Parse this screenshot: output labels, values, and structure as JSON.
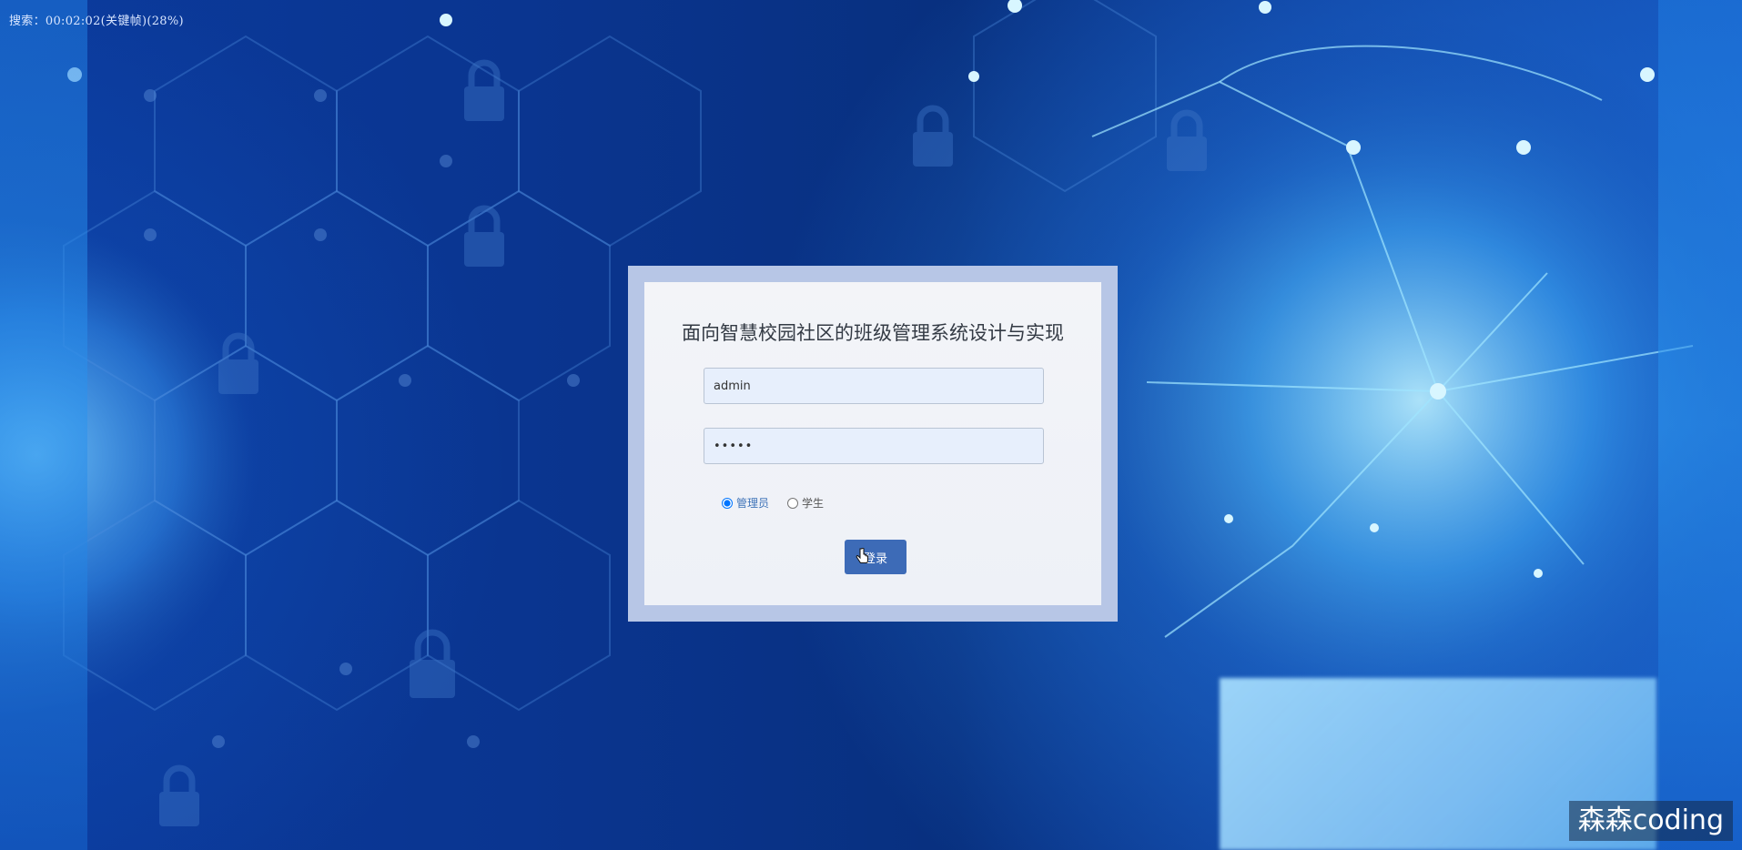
{
  "overlay": {
    "timestamp": "搜索：00:02:02(关键帧)(28%)",
    "watermark": "森森coding"
  },
  "login": {
    "title": "面向智慧校园社区的班级管理系统设计与实现",
    "username_value": "admin",
    "password_value": "•••••",
    "roles": [
      {
        "label": "管理员",
        "selected": true
      },
      {
        "label": "学生",
        "selected": false
      }
    ],
    "submit_label": "登录"
  },
  "colors": {
    "background_primary": "#0a3590",
    "frame": "#b7c6e6",
    "card": "#f3f4f8",
    "input_fill": "#e7effc",
    "button": "#3d6bb7",
    "selected_role": "#3e73b8"
  },
  "icons": {
    "cursor": "hand-pointer-icon"
  }
}
